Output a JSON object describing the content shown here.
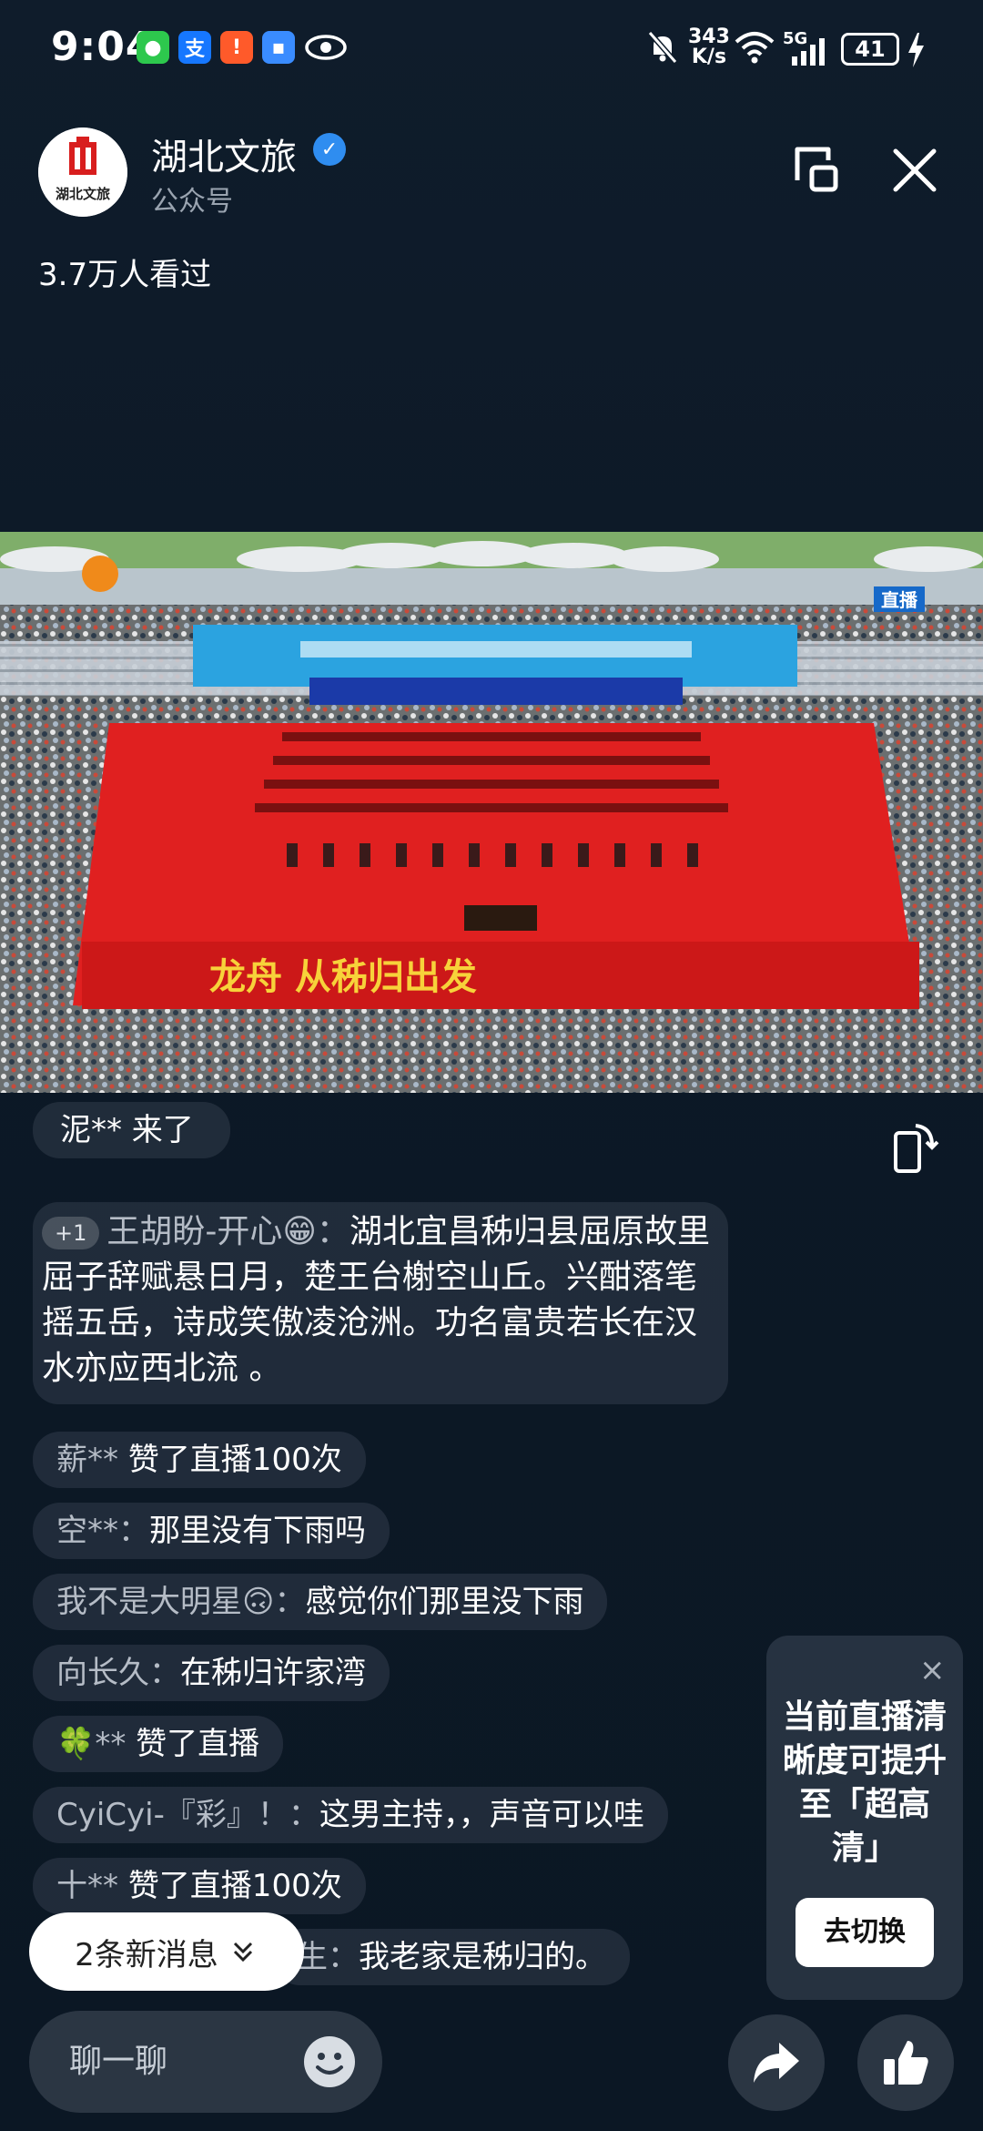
{
  "status_bar": {
    "time": "9:04",
    "speed_value": "343",
    "speed_unit": "K/s",
    "network": "5G",
    "battery": "41"
  },
  "header": {
    "account_name": "湖北文旅",
    "account_type": "公众号",
    "views": "3.7万人看过",
    "logo_text": "湖北文旅"
  },
  "video": {
    "stage_banner": "龙舟  从秭归出发",
    "live_label": "直播"
  },
  "comments": {
    "join": "泥** 来了",
    "featured": {
      "level": "+1",
      "nick": "王胡盼-开心😁",
      "text1": "湖北宜昌秭归县屈原故里",
      "text2": "屈子辞赋悬日月，楚王台榭空山丘。兴酣落笔摇五岳，诗成笑傲凌沧洲。功名富贵若长在汉水亦应西北流 。"
    },
    "items": [
      {
        "nick": "薪**",
        "sep": " ",
        "text": "赞了直播100次"
      },
      {
        "nick": "空**",
        "sep": "：",
        "text": "那里没有下雨吗"
      },
      {
        "nick": "我不是大明星🙃",
        "sep": "：",
        "text": "感觉你们那里没下雨"
      },
      {
        "nick": "向长久",
        "sep": "：",
        "text": "在秭归许家湾"
      },
      {
        "nick": "🍀**",
        "sep": " ",
        "text": "赞了直播"
      },
      {
        "nick": "CyiCyi-『彩』！",
        "sep": "：",
        "text": "这男主持，，声音可以哇"
      },
      {
        "nick": "十**",
        "sep": " ",
        "text": "赞了直播100次"
      },
      {
        "nick": "生",
        "sep": "：",
        "text": "我老家是秭归的。"
      }
    ]
  },
  "quality_popup": {
    "text": "当前直播清晰度可提升至「超高清」",
    "button": "去切换",
    "close": "×"
  },
  "new_messages": "2条新消息",
  "bottom": {
    "chat_placeholder": "聊一聊"
  }
}
